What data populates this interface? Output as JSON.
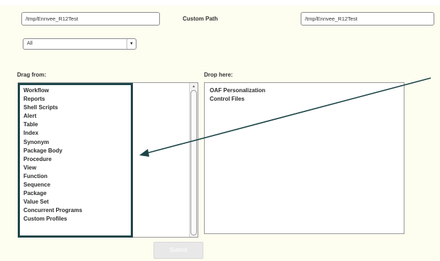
{
  "form": {
    "path_value": "/tmp/Ennvee_R12Test",
    "custom_path_label": "Custom Path",
    "custom_path_value": "/tmp/Ennvee_R12Test",
    "filter_selected": "All"
  },
  "drag": {
    "label": "Drag from:",
    "items": [
      "Workflow",
      "Reports",
      "Shell Scripts",
      "Alert",
      "Table",
      "Index",
      "Synonym",
      "Package Body",
      "Procedure",
      "View",
      "Function",
      "Sequence",
      "Package",
      "Value Set",
      "Concurrent Programs",
      "Custom Profiles"
    ]
  },
  "drop": {
    "label": "Drop here:",
    "items": [
      "OAF Personalization",
      "Control Files"
    ]
  },
  "submit_label": "Submit",
  "colors": {
    "background": "#fdfdf0",
    "highlight": "#1d4548"
  },
  "icons": {
    "select_arrow": "chevron-down-icon",
    "scroll_up": "scroll-up-arrow-icon"
  }
}
